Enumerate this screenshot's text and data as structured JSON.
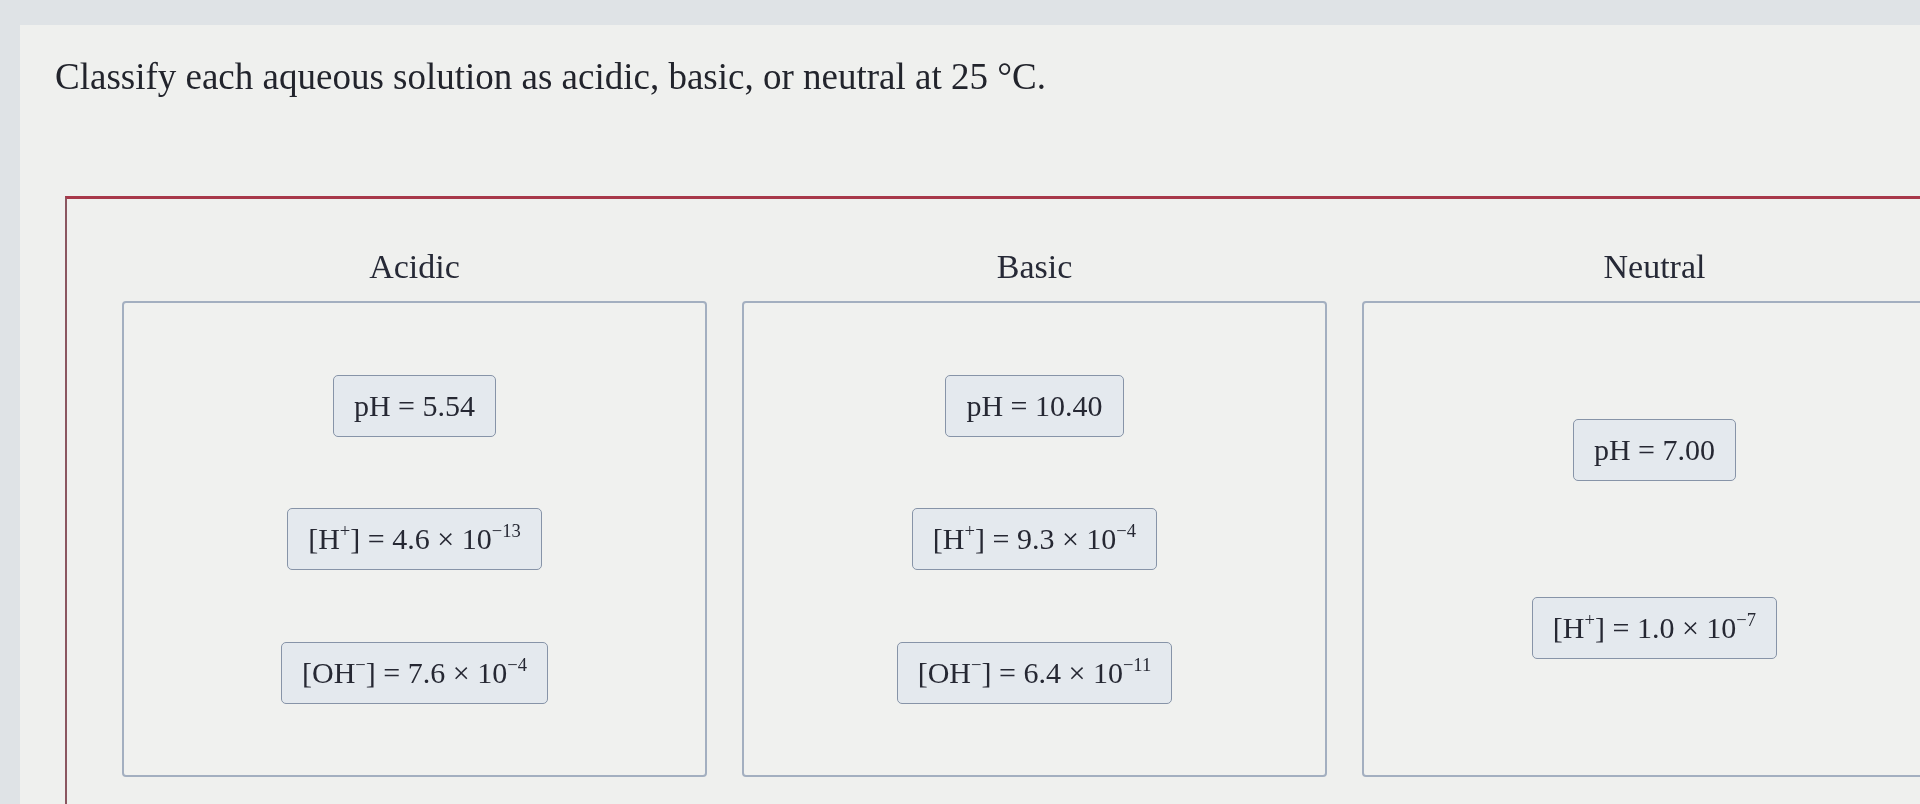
{
  "question": "Classify each aqueous solution as acidic, basic, or neutral at 25 °C.",
  "bins": [
    {
      "label": "Acidic",
      "items": [
        "pH = 5.54",
        "[H$^{+}$] = 4.6 × 10$^{−13}$",
        "[OH$^{−}$] = 7.6 × 10$^{−4}$"
      ]
    },
    {
      "label": "Basic",
      "items": [
        "pH = 10.40",
        "[H$^{+}$] = 9.3 × 10$^{−4}$",
        "[OH$^{−}$] = 6.4 × 10$^{−11}$"
      ]
    },
    {
      "label": "Neutral",
      "items": [
        "pH = 7.00",
        "[H$^{+}$] = 1.0 × 10$^{−7}$"
      ]
    }
  ]
}
